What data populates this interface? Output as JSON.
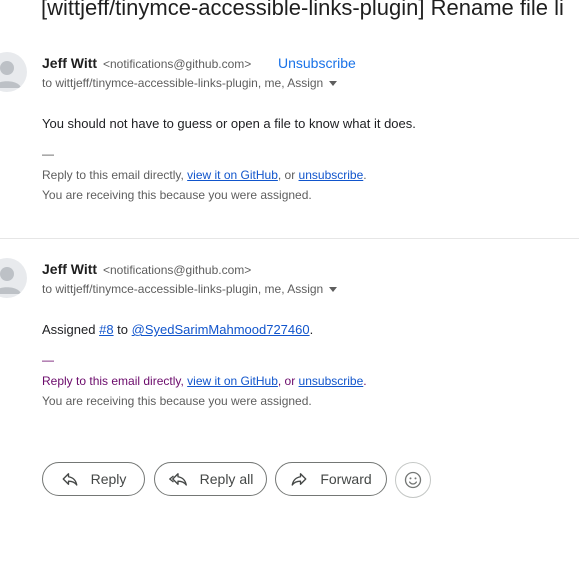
{
  "subject": "[wittjeff/tinymce-accessible-links-plugin] Rename file li",
  "messages": [
    {
      "sender_name": "Jeff Witt",
      "sender_email": "<notifications@github.com>",
      "unsubscribe_label": "Unsubscribe",
      "to_line": "to wittjeff/tinymce-accessible-links-plugin, me, Assign",
      "body": "You should not have to guess or open a file to know what it does.",
      "separator": "—",
      "footer_prefix": "Reply to this email directly, ",
      "footer_view_link": "view it on GitHub",
      "footer_mid": ", or ",
      "footer_unsub_link": "unsubscribe",
      "footer_end": ".",
      "footer_note": "You are receiving this because you were assigned."
    },
    {
      "sender_name": "Jeff Witt",
      "sender_email": "<notifications@github.com>",
      "to_line": "to wittjeff/tinymce-accessible-links-plugin, me, Assign",
      "body_prefix": "Assigned ",
      "body_issue_link": "#8",
      "body_mid": " to ",
      "body_user_link": "@SyedSarimMahmood727460",
      "body_end": ".",
      "separator": "—",
      "footer_prefix": "Reply to this email directly, ",
      "footer_view_link": "view it on GitHub",
      "footer_mid": ", or ",
      "footer_unsub_link": "unsubscribe",
      "footer_end": ".",
      "footer_note": "You are receiving this because you were assigned."
    }
  ],
  "actions": {
    "reply": "Reply",
    "reply_all": "Reply all",
    "forward": "Forward",
    "emoji_icon": "emoji-smile-icon"
  },
  "colors": {
    "link": "#1155cc",
    "unsubscribe": "#1a73e8",
    "visited_footer": "#6b0a6b"
  }
}
